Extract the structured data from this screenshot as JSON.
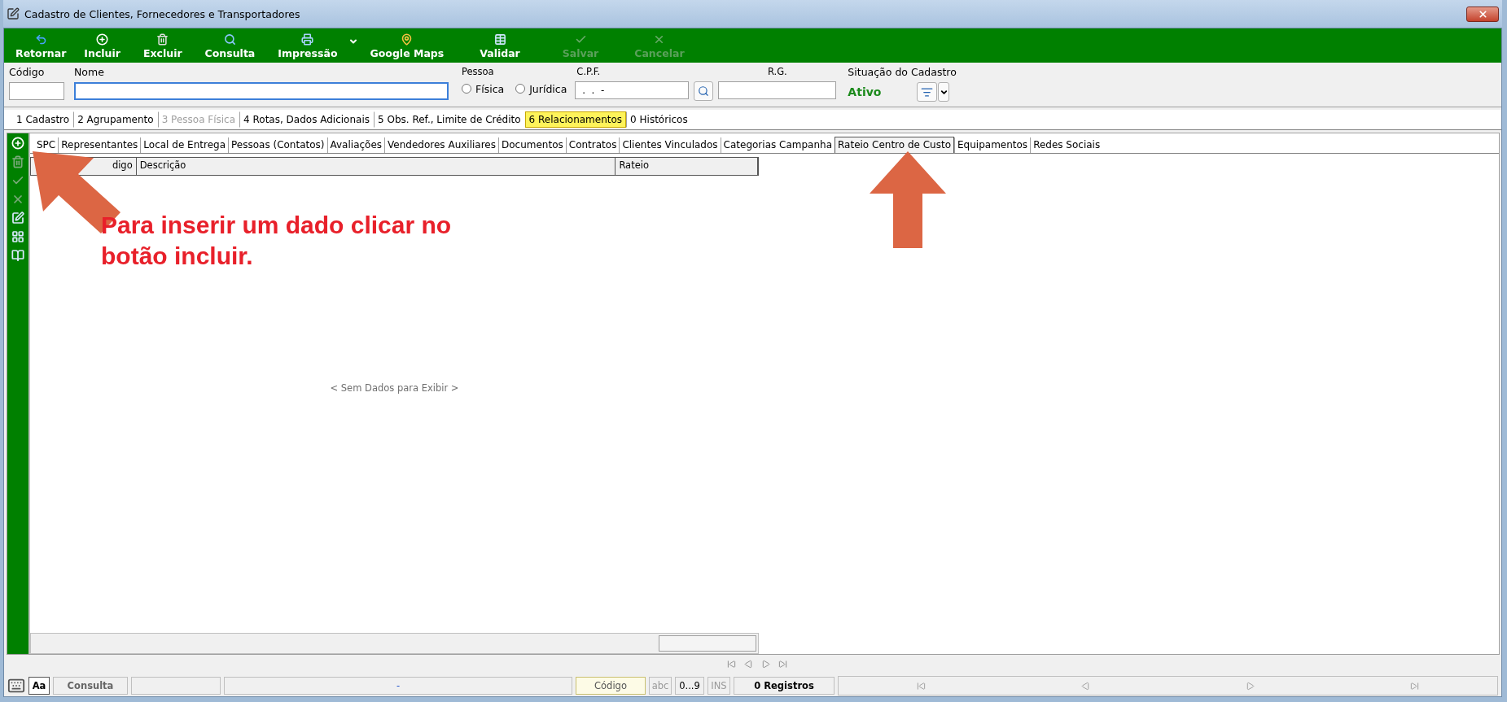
{
  "window": {
    "title": "Cadastro de Clientes, Fornecedores e Transportadores"
  },
  "toolbar": [
    {
      "label": "Retornar",
      "disabled": false
    },
    {
      "label": "Incluir",
      "disabled": false
    },
    {
      "label": "Excluir",
      "disabled": false
    },
    {
      "label": "Consulta",
      "disabled": false
    },
    {
      "label": "Impressão",
      "disabled": false,
      "dropdown": true
    },
    {
      "label": "Google Maps",
      "disabled": false
    },
    {
      "label": "Validar",
      "disabled": false
    },
    {
      "label": "Salvar",
      "disabled": true
    },
    {
      "label": "Cancelar",
      "disabled": true
    }
  ],
  "form": {
    "codigo": {
      "label": "Código"
    },
    "nome": {
      "label": "Nome",
      "focused": true
    },
    "pessoa": {
      "label": "Pessoa",
      "options": [
        {
          "label": "Física",
          "selected": false
        },
        {
          "label": "Jurídica",
          "selected": false
        }
      ]
    },
    "cpf": {
      "label": "C.P.F.",
      "value": " .  .  -"
    },
    "rg": {
      "label": "R.G."
    },
    "situacao": {
      "label": "Situação do Cadastro",
      "value": "Ativo"
    }
  },
  "tabs": [
    {
      "label": "1 Cadastro",
      "selected": false,
      "disabled": false
    },
    {
      "label": "2 Agrupamento",
      "selected": false,
      "disabled": false
    },
    {
      "label": "3 Pessoa Física",
      "selected": false,
      "disabled": true
    },
    {
      "label": "4 Rotas, Dados Adicionais",
      "selected": false,
      "disabled": false
    },
    {
      "label": "5 Obs. Ref., Limite de Crédito",
      "selected": false,
      "disabled": false
    },
    {
      "label": "6 Relacionamentos",
      "selected": true,
      "disabled": false
    },
    {
      "label": "0 Históricos",
      "selected": false,
      "disabled": false
    }
  ],
  "subtabs": [
    {
      "label": "SPC",
      "selected": false
    },
    {
      "label": "Representantes",
      "selected": false
    },
    {
      "label": "Local de Entrega",
      "selected": false
    },
    {
      "label": "Pessoas (Contatos)",
      "selected": false
    },
    {
      "label": "Avaliações",
      "selected": false
    },
    {
      "label": "Vendedores Auxiliares",
      "selected": false
    },
    {
      "label": "Documentos",
      "selected": false
    },
    {
      "label": "Contratos",
      "selected": false
    },
    {
      "label": "Clientes Vinculados",
      "selected": false
    },
    {
      "label": "Categorias Campanha",
      "selected": false
    },
    {
      "label": "Rateio Centro de Custo",
      "selected": true
    },
    {
      "label": "Equipamentos",
      "selected": false
    },
    {
      "label": "Redes Sociais",
      "selected": false
    }
  ],
  "side_toolbar": [
    {
      "disabled": false
    },
    {
      "disabled": true
    },
    {
      "disabled": true
    },
    {
      "disabled": true
    },
    {
      "disabled": false
    },
    {
      "disabled": false
    },
    {
      "disabled": false
    }
  ],
  "table": {
    "columns": [
      "digo",
      "Descrição",
      "Rateio"
    ],
    "empty_message": "< Sem Dados para Exibir >"
  },
  "annotation": {
    "lines": [
      "Para inserir um dado clicar no",
      "botão incluir."
    ]
  },
  "status_bar": {
    "mode_key": "Aa",
    "mode": "Consulta",
    "field_2": "-",
    "order": "Código",
    "abc": "abc",
    "digits": "0...9",
    "ins": "INS",
    "count": "0 Registros"
  }
}
